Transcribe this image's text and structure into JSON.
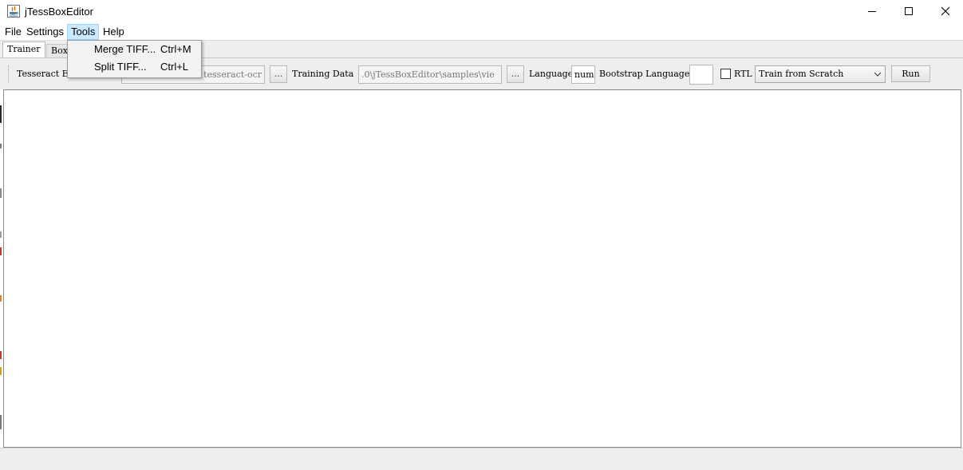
{
  "window": {
    "title": "jTessBoxEditor",
    "controls": [
      "minimize-icon",
      "maximize-icon",
      "close-icon"
    ]
  },
  "menubar": {
    "file": "File",
    "settings": "Settings",
    "tools": "Tools",
    "help": "Help",
    "active_menu": "Tools"
  },
  "tools_menu": {
    "items": [
      {
        "label": "Merge TIFF...",
        "shortcut": "Ctrl+M"
      },
      {
        "label": "Split TIFF...",
        "shortcut": "Ctrl+L"
      }
    ]
  },
  "tabs": {
    "items": [
      "Trainer",
      "Box"
    ],
    "selected": "Trainer"
  },
  "toolbar": {
    "tesseract_label": "Tesseract E",
    "tesseract_value": "tesseract-ocr",
    "browse_label": "...",
    "training_data_label": "Training Data",
    "training_data_value": ".0\\jTessBoxEditor\\samples\\vie",
    "language_label": "Language",
    "language_value": "num",
    "bootstrap_label": "Bootstrap Language",
    "bootstrap_value": "",
    "rtl_label": "RTL",
    "rtl_checked": false,
    "mode_selected": "Train from Scratch",
    "run_label": "Run"
  },
  "colors": {
    "menu_highlight": "#cce8ff",
    "panel_bg": "#eeeeee",
    "content_bg": "#ffffff"
  }
}
